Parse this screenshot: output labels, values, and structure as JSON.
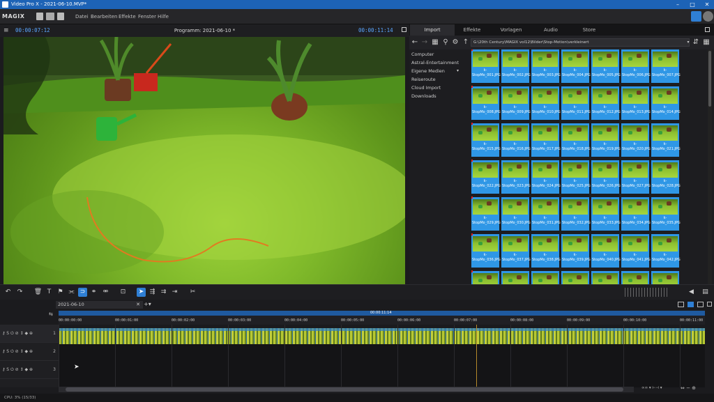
{
  "window": {
    "title": "Video Pro X - 2021-06-10.MVP*",
    "brand": "MAGIX"
  },
  "menu": {
    "items": [
      "Datei",
      "Bearbeiten",
      "Effekte",
      "Fenster",
      "Hilfe"
    ]
  },
  "preview": {
    "timecode_left": "00:00:07:12",
    "title": "Programm: 2021-06-10 *",
    "timecode_right": "00:00:11:14",
    "scrub_label": "11:14"
  },
  "mediapool": {
    "tabs": [
      "Import",
      "Effekte",
      "Vorlagen",
      "Audio",
      "Store"
    ],
    "active_tab": "Import",
    "path": "G:\\20th Century\\MAGIX vol12\\Bilder\\Stop-Motion\\verkleinert",
    "folders": [
      "Computer",
      "Astral-Entertainment",
      "Eigene Medien",
      "Reiseroute",
      "Cloud Import",
      "Downloads"
    ],
    "thumbnails": [
      "k-StopMo_001.JPG",
      "k-StopMo_002.JPG",
      "k-StopMo_003.JPG",
      "k-StopMo_004.JPG",
      "k-StopMo_005.JPG",
      "k-StopMo_006.JPG",
      "k-StopMo_007.JPG",
      "k-StopMo_008.JPG",
      "k-StopMo_009.JPG",
      "k-StopMo_010.JPG",
      "k-StopMo_011.JPG",
      "k-StopMo_012.JPG",
      "k-StopMo_013.JPG",
      "k-StopMo_014.JPG",
      "k-StopMo_015.JPG",
      "k-StopMo_016.JPG",
      "k-StopMo_017.JPG",
      "k-StopMo_018.JPG",
      "k-StopMo_019.JPG",
      "k-StopMo_020.JPG",
      "k-StopMo_021.JPG",
      "k-StopMo_022.JPG",
      "k-StopMo_023.JPG",
      "k-StopMo_024.JPG",
      "k-StopMo_025.JPG",
      "k-StopMo_026.JPG",
      "k-StopMo_027.JPG",
      "k-StopMo_028.JPG",
      "k-StopMo_029.JPG",
      "k-StopMo_030.JPG",
      "k-StopMo_031.JPG",
      "k-StopMo_032.JPG",
      "k-StopMo_033.JPG",
      "k-StopMo_034.JPG",
      "k-StopMo_035.JPG",
      "k-StopMo_036.JPG",
      "k-StopMo_037.JPG",
      "k-StopMo_038.JPG",
      "k-StopMo_039.JPG",
      "k-StopMo_040.JPG",
      "k-StopMo_041.JPG",
      "k-StopMo_042.JPG",
      "",
      "",
      "",
      "",
      "",
      "",
      ""
    ]
  },
  "timeline": {
    "tab": "2021-06-10",
    "playhead_label": "00:00:11:14",
    "ruler": [
      "00:00:00:00",
      "00:00:01:00",
      "00:00:02:00",
      "00:00:03:00",
      "00:00:04:00",
      "00:00:05:00",
      "00:00:06:00",
      "00:00:07:00",
      "00:00:08:00",
      "00:00:09:00",
      "00:00:10:00",
      "00:00:11:00"
    ],
    "tracks": [
      "1",
      "2",
      "3"
    ]
  },
  "status": {
    "text": "CPU: 3% (15/33)"
  },
  "colors": {
    "accent": "#2f97e6",
    "title_bar": "#1d63b6",
    "timecode": "#5aa6ff"
  }
}
